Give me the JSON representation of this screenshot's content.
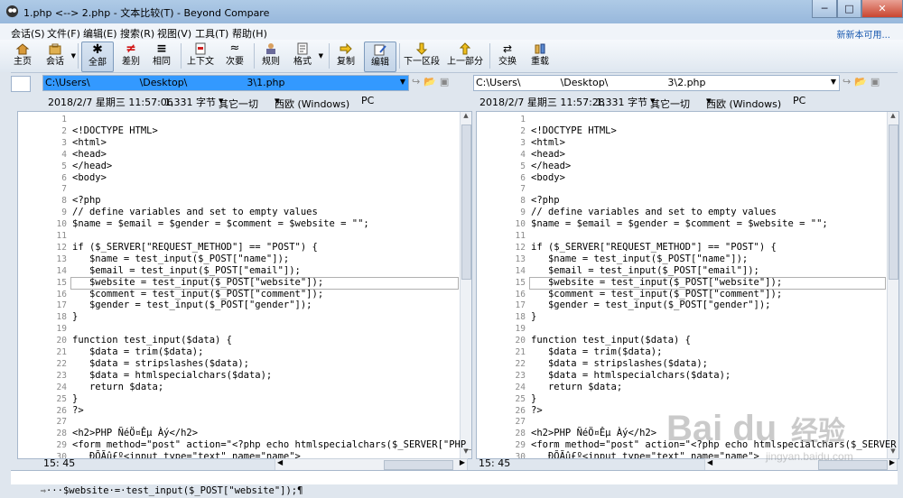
{
  "window": {
    "title": "1.php <--> 2.php - 文本比较(T) - Beyond Compare",
    "controls": {
      "minimize": "─",
      "maximize": "□",
      "close": "✕"
    }
  },
  "menu": {
    "items": [
      "会话(S)",
      "文件(F)",
      "编辑(E)",
      "搜索(R)",
      "视图(V)",
      "工具(T)",
      "帮助(H)"
    ],
    "new_version": "新新本可用..."
  },
  "toolbar": {
    "buttons": [
      {
        "label": "主页",
        "icon": "home-icon"
      },
      {
        "label": "会话",
        "icon": "session-icon"
      },
      {
        "label": "全部",
        "icon": "all-icon",
        "pressed": true
      },
      {
        "label": "差别",
        "icon": "diff-icon"
      },
      {
        "label": "相同",
        "icon": "same-icon"
      },
      {
        "label": "上下文",
        "icon": "context-icon"
      },
      {
        "label": "次要",
        "icon": "minor-icon"
      },
      {
        "label": "规则",
        "icon": "rules-icon"
      },
      {
        "label": "格式",
        "icon": "format-icon"
      },
      {
        "label": "复制",
        "icon": "copy-icon"
      },
      {
        "label": "编辑",
        "icon": "edit-icon",
        "pressed": true
      },
      {
        "label": "下一区段",
        "icon": "next-section-icon"
      },
      {
        "label": "上一部分",
        "icon": "prev-section-icon"
      },
      {
        "label": "交换",
        "icon": "swap-icon"
      },
      {
        "label": "重载",
        "icon": "reload-icon"
      }
    ]
  },
  "left": {
    "path": "C:\\Users\\     \\Desktop\\      3\\1.php",
    "date": "2018/2/7 星期三 11:57:06",
    "size": "1,331 字节",
    "filter": "其它一切",
    "encoding": "西欧 (Windows)",
    "lineend": "PC",
    "position": "15: 45"
  },
  "right": {
    "path": "C:\\Users\\    \\Desktop\\      3\\2.php",
    "date": "2018/2/7 星期三 11:57:28",
    "size": "1,331 字节",
    "filter": "其它一切",
    "encoding": "西欧 (Windows)",
    "lineend": "PC",
    "position": "15: 45"
  },
  "code": [
    {
      "n": "1",
      "t": ""
    },
    {
      "n": "2",
      "t": "<!DOCTYPE HTML>"
    },
    {
      "n": "3",
      "t": "<html>"
    },
    {
      "n": "4",
      "t": "<head>"
    },
    {
      "n": "5",
      "t": "</head>"
    },
    {
      "n": "6",
      "t": "<body>"
    },
    {
      "n": "7",
      "t": ""
    },
    {
      "n": "8",
      "t": "<?php"
    },
    {
      "n": "9",
      "t": "// define variables and set to empty values"
    },
    {
      "n": "10",
      "t": "$name = $email = $gender = $comment = $website = \"\";"
    },
    {
      "n": "11",
      "t": ""
    },
    {
      "n": "12",
      "t": "if ($_SERVER[\"REQUEST_METHOD\"] == \"POST\") {"
    },
    {
      "n": "13",
      "t": "   $name = test_input($_POST[\"name\"]);"
    },
    {
      "n": "14",
      "t": "   $email = test_input($_POST[\"email\"]);"
    },
    {
      "n": "15",
      "t": "   $website = test_input($_POST[\"website\"]);"
    },
    {
      "n": "16",
      "t": "   $comment = test_input($_POST[\"comment\"]);"
    },
    {
      "n": "17",
      "t": "   $gender = test_input($_POST[\"gender\"]);"
    },
    {
      "n": "18",
      "t": "}"
    },
    {
      "n": "19",
      "t": ""
    },
    {
      "n": "20",
      "t": "function test_input($data) {"
    },
    {
      "n": "21",
      "t": "   $data = trim($data);"
    },
    {
      "n": "22",
      "t": "   $data = stripslashes($data);"
    },
    {
      "n": "23",
      "t": "   $data = htmlspecialchars($data);"
    },
    {
      "n": "24",
      "t": "   return $data;"
    },
    {
      "n": "25",
      "t": "}"
    },
    {
      "n": "26",
      "t": "?>"
    },
    {
      "n": "27",
      "t": ""
    },
    {
      "n": "28",
      "t": "<h2>PHP ÑéÖ¤Êµ Àý</h2>"
    },
    {
      "n": "29",
      "t": "<form method=\"post\" action=\"<?php echo htmlspecialchars($_SERVER[\"PHP_SELF\"]);?>\">"
    },
    {
      "n": "30",
      "t": "   ÐÕÃû£º<input type=\"text\" name=\"name\">"
    }
  ],
  "current_line": "15",
  "bottom_text": "···$website·=·test_input($_POST[\"website\"]);¶",
  "watermark": {
    "brand": "Bai du",
    "sub": "经验",
    "url": "jingyan.baidu.com"
  },
  "colors": {
    "selected_path": "#3399ff",
    "titlebar": "#a9c6e4",
    "close": "#c9452f"
  }
}
